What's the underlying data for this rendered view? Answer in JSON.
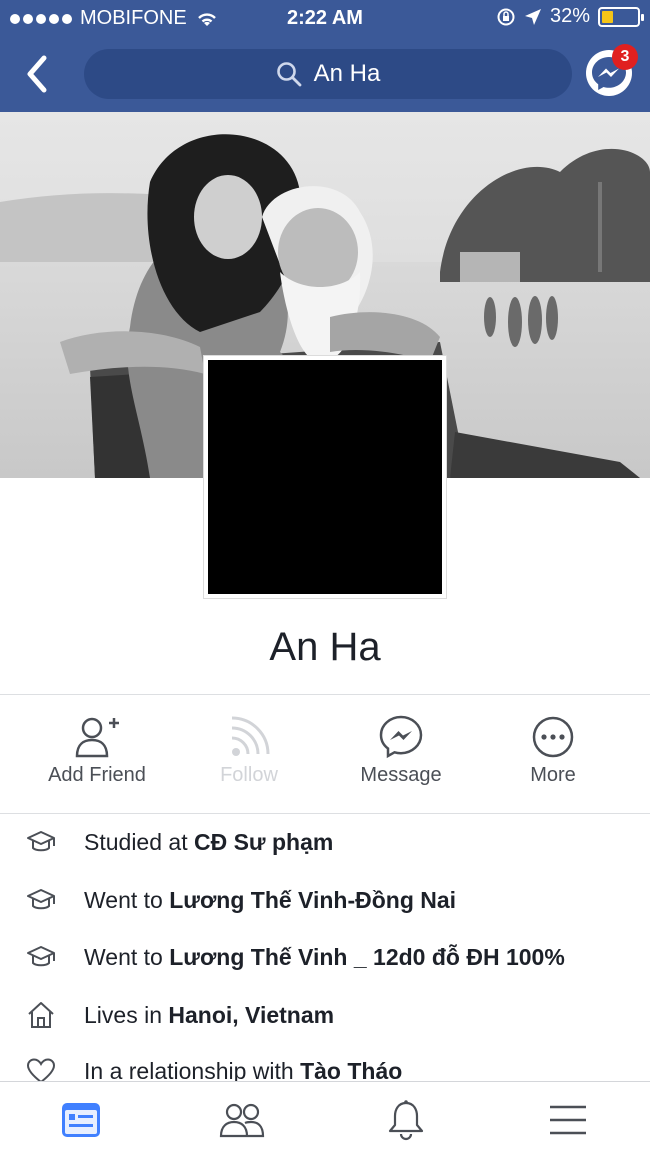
{
  "status_bar": {
    "carrier": "MOBIFONE",
    "time": "2:22 AM",
    "battery_percent_label": "32%",
    "battery_level": 0.32
  },
  "header": {
    "search_text": "An Ha",
    "messenger_badge_count": "3"
  },
  "profile": {
    "name": "An Ha"
  },
  "actions": [
    {
      "label": "Add Friend",
      "icon": "add-friend-icon",
      "enabled": true
    },
    {
      "label": "Follow",
      "icon": "follow-icon",
      "enabled": false
    },
    {
      "label": "Message",
      "icon": "messenger-icon",
      "enabled": true
    },
    {
      "label": "More",
      "icon": "more-icon",
      "enabled": true
    }
  ],
  "info": [
    {
      "prefix": "Studied at ",
      "value": "CĐ Sư phạm",
      "icon": "graduation-cap-icon"
    },
    {
      "prefix": "Went to ",
      "value": "Lương Thế Vinh-Đồng Nai",
      "icon": "graduation-cap-icon"
    },
    {
      "prefix": "Went to ",
      "value": "Lương Thế Vinh _ 12d0 đỗ ĐH 100%",
      "icon": "graduation-cap-icon"
    },
    {
      "prefix": "Lives in ",
      "value": "Hanoi, Vietnam",
      "icon": "home-icon"
    },
    {
      "prefix": "In a relationship with ",
      "value": "Tào Tháo",
      "icon": "heart-icon"
    }
  ],
  "bottom_nav": [
    "news-feed-icon",
    "friends-icon",
    "notifications-icon",
    "menu-icon"
  ],
  "colors": {
    "brand_blue": "#3b5998",
    "search_bg": "#2d4a86",
    "badge_red": "#e02020",
    "battery_yellow": "#f5c518"
  }
}
